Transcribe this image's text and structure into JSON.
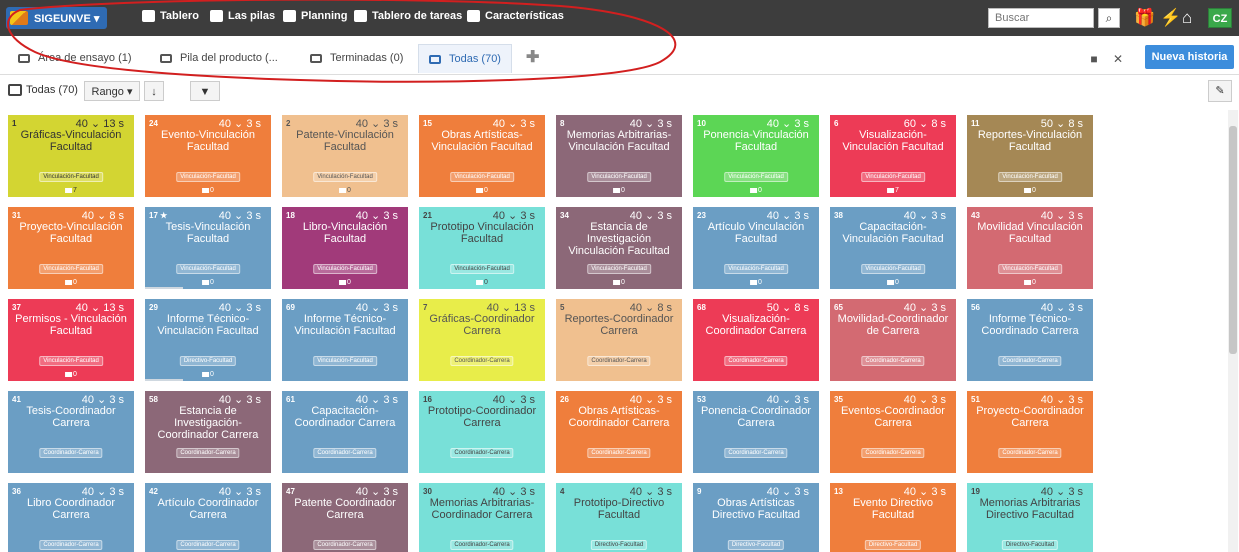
{
  "topbar": {
    "project": "SIGEUNVE ▾",
    "nav": [
      {
        "label": "Tablero",
        "icon": "dashboard-icon"
      },
      {
        "label": "Las pilas",
        "icon": "inbox-icon"
      },
      {
        "label": "Planning",
        "icon": "calendar-icon"
      },
      {
        "label": "Tablero de tareas",
        "icon": "taskboard-icon"
      },
      {
        "label": "Características",
        "icon": "features-icon"
      }
    ],
    "search_placeholder": "Buscar",
    "user_initials": "CZ"
  },
  "tabs": [
    {
      "label": "Área de ensayo (1)"
    },
    {
      "label": "Pila del producto (..."
    },
    {
      "label": "Terminadas (0)"
    },
    {
      "label": "Todas (70)"
    }
  ],
  "new_story_label": "Nueva historia",
  "filter": {
    "label": "Todas (70)",
    "range_label": "Rango ▾"
  },
  "cards": [
    {
      "num": "1",
      "pts": "40 ⌄ 13 s",
      "title": "Gráficas-Vinculación Facultad",
      "tag": "Vinculación-Facultad",
      "tasks": "7",
      "color": "#d3d532",
      "text": "#333333",
      "bar": 0
    },
    {
      "num": "24",
      "pts": "40 ⌄ 3 s",
      "title": "Evento-Vinculación Facultad",
      "tag": "Vinculación-Facultad",
      "tasks": "0",
      "color": "#ef7e3c",
      "text": "#ffffff",
      "bar": 0
    },
    {
      "num": "2",
      "pts": "40 ⌄ 3 s",
      "title": "Patente-Vinculación Facultad",
      "tag": "Vinculación-Facultad",
      "tasks": "0",
      "color": "#f0c08f",
      "text": "#555555",
      "bar": 0
    },
    {
      "num": "15",
      "pts": "40 ⌄ 3 s",
      "title": "Obras Artísticas-Vinculación Facultad",
      "tag": "Vinculación-Facultad",
      "tasks": "0",
      "color": "#ef7e3c",
      "text": "#ffffff",
      "bar": 0
    },
    {
      "num": "8",
      "pts": "40 ⌄ 3 s",
      "title": "Memorias Arbitrarias-Vinculación Facultad",
      "tag": "Vinculación-Facultad",
      "tasks": "0",
      "color": "#8c6878",
      "text": "#ffffff",
      "bar": 0
    },
    {
      "num": "10",
      "pts": "40 ⌄ 3 s",
      "title": "Ponencia-Vinculación Facultad",
      "tag": "Vinculación-Facultad",
      "tasks": "0",
      "color": "#5cd655",
      "text": "#ffffff",
      "bar": 0
    },
    {
      "num": "6",
      "pts": "60 ⌄ 8 s",
      "title": "Visualización-Vinculación Facultad",
      "tag": "Vinculación-Facultad",
      "tasks": "7",
      "color": "#ed3b56",
      "text": "#ffffff",
      "bar": 0
    },
    {
      "num": "11",
      "pts": "50 ⌄ 8 s",
      "title": "Reportes-Vinculación Facultad",
      "tag": "Vinculación-Facultad",
      "tasks": "0",
      "color": "#a58855",
      "text": "#ffffff",
      "bar": 0
    },
    {
      "num": "31",
      "pts": "40 ⌄ 8 s",
      "title": "Proyecto-Vinculación Facultad",
      "tag": "Vinculación-Facultad",
      "tasks": "0",
      "color": "#ef7e3c",
      "text": "#ffffff",
      "bar": 0
    },
    {
      "num": "17 ★",
      "pts": "40 ⌄ 3 s",
      "title": "Tesis-Vinculación Facultad",
      "tag": "Vinculación-Facultad",
      "tasks": "0",
      "color": "#6b9ec4",
      "text": "#ffffff",
      "bar": 0.3
    },
    {
      "num": "18",
      "pts": "40 ⌄ 3 s",
      "title": "Libro-Vinculación Facultad",
      "tag": "Vinculación-Facultad",
      "tasks": "0",
      "color": "#a13a7a",
      "text": "#ffffff",
      "bar": 0
    },
    {
      "num": "21",
      "pts": "40 ⌄ 3 s",
      "title": "Prototipo Vinculación Facultad",
      "tag": "Vinculación-Facultad",
      "tasks": "0",
      "color": "#78e0d8",
      "text": "#444444",
      "bar": 0
    },
    {
      "num": "34",
      "pts": "40 ⌄ 3 s",
      "title": "Estancia de Investigación Vinculación Facultad",
      "tag": "Vinculación-Facultad",
      "tasks": "0",
      "color": "#8c6878",
      "text": "#ffffff",
      "bar": 0
    },
    {
      "num": "23",
      "pts": "40 ⌄ 3 s",
      "title": "Artículo Vinculación Facultad",
      "tag": "Vinculación-Facultad",
      "tasks": "0",
      "color": "#6b9ec4",
      "text": "#ffffff",
      "bar": 0
    },
    {
      "num": "38",
      "pts": "40 ⌄ 3 s",
      "title": "Capacitación-Vinculación Facultad",
      "tag": "Vinculación-Facultad",
      "tasks": "0",
      "color": "#6b9ec4",
      "text": "#ffffff",
      "bar": 0
    },
    {
      "num": "43",
      "pts": "40 ⌄ 3 s",
      "title": "Movilidad Vinculación Facultad",
      "tag": "Vinculación-Facultad",
      "tasks": "0",
      "color": "#d36a72",
      "text": "#ffffff",
      "bar": 0
    },
    {
      "num": "37",
      "pts": "40 ⌄ 13 s",
      "title": "Permisos - Vinculación Facultad",
      "tag": "Vinculación-Facultad",
      "tasks": "0",
      "color": "#ed3b56",
      "text": "#ffffff",
      "bar": 0
    },
    {
      "num": "29",
      "pts": "40 ⌄ 3 s",
      "title": "Informe Técnico-Vinculación Facultad",
      "tag": "Directivo-Facultad",
      "tasks": "0",
      "color": "#6b9ec4",
      "text": "#ffffff",
      "bar": 0.3
    },
    {
      "num": "69",
      "pts": "40 ⌄ 3 s",
      "title": "Informe Técnico-Vinculación Facultad",
      "tag": "Vinculación-Facultad",
      "tasks": "",
      "color": "#6b9ec4",
      "text": "#ffffff",
      "bar": 0
    },
    {
      "num": "7",
      "pts": "40 ⌄ 13 s",
      "title": "Gráficas-Coordinador Carrera",
      "tag": "Coordinador-Carrera",
      "tasks": "",
      "color": "#e8ed4a",
      "text": "#555555",
      "bar": 0
    },
    {
      "num": "5",
      "pts": "40 ⌄ 8 s",
      "title": "Reportes-Coordinador Carrera",
      "tag": "Coordinador-Carrera",
      "tasks": "",
      "color": "#f0c08f",
      "text": "#555555",
      "bar": 0
    },
    {
      "num": "68",
      "pts": "50 ⌄ 8 s",
      "title": "Visualización-Coordinador Carrera",
      "tag": "Coordinador-Carrera",
      "tasks": "",
      "color": "#ed3b56",
      "text": "#ffffff",
      "bar": 0
    },
    {
      "num": "65",
      "pts": "40 ⌄ 3 s",
      "title": "Movilidad-Coordinador de Carrera",
      "tag": "Coordinador-Carrera",
      "tasks": "",
      "color": "#d36a72",
      "text": "#ffffff",
      "bar": 0
    },
    {
      "num": "56",
      "pts": "40 ⌄ 3 s",
      "title": "Informe Técnico-Coordinado Carrera",
      "tag": "Coordinador-Carrera",
      "tasks": "",
      "color": "#6b9ec4",
      "text": "#ffffff",
      "bar": 0
    },
    {
      "num": "41",
      "pts": "40 ⌄ 3 s",
      "title": "Tesis-Coordinador Carrera",
      "tag": "Coordinador-Carrera",
      "tasks": "",
      "color": "#6b9ec4",
      "text": "#ffffff",
      "bar": 0
    },
    {
      "num": "58",
      "pts": "40 ⌄ 3 s",
      "title": "Estancia de Investigación-Coordinador Carrera",
      "tag": "Coordinador-Carrera",
      "tasks": "",
      "color": "#8c6878",
      "text": "#ffffff",
      "bar": 0
    },
    {
      "num": "61",
      "pts": "40 ⌄ 3 s",
      "title": "Capacitación-Coordinador Carrera",
      "tag": "Coordinador-Carrera",
      "tasks": "",
      "color": "#6b9ec4",
      "text": "#ffffff",
      "bar": 0
    },
    {
      "num": "16",
      "pts": "40 ⌄ 3 s",
      "title": "Prototipo-Coordinador Carrera",
      "tag": "Coordinador-Carrera",
      "tasks": "",
      "color": "#78e0d8",
      "text": "#444444",
      "bar": 0
    },
    {
      "num": "26",
      "pts": "40 ⌄ 3 s",
      "title": "Obras Artísticas-Coordinador Carrera",
      "tag": "Coordinador-Carrera",
      "tasks": "",
      "color": "#ef7e3c",
      "text": "#ffffff",
      "bar": 0
    },
    {
      "num": "53",
      "pts": "40 ⌄ 3 s",
      "title": "Ponencia-Coordinador Carrera",
      "tag": "Coordinador-Carrera",
      "tasks": "",
      "color": "#6b9ec4",
      "text": "#ffffff",
      "bar": 0
    },
    {
      "num": "35",
      "pts": "40 ⌄ 3 s",
      "title": "Eventos-Coordinador Carrera",
      "tag": "Coordinador-Carrera",
      "tasks": "",
      "color": "#ef7e3c",
      "text": "#ffffff",
      "bar": 0
    },
    {
      "num": "51",
      "pts": "40 ⌄ 3 s",
      "title": "Proyecto-Coordinador Carrera",
      "tag": "Coordinador-Carrera",
      "tasks": "",
      "color": "#ef7e3c",
      "text": "#ffffff",
      "bar": 0
    },
    {
      "num": "36",
      "pts": "40 ⌄ 3 s",
      "title": "Libro Coordinador Carrera",
      "tag": "Coordinador-Carrera",
      "tasks": "",
      "color": "#6b9ec4",
      "text": "#ffffff",
      "bar": 0
    },
    {
      "num": "42",
      "pts": "40 ⌄ 3 s",
      "title": "Artículo Coordinador Carrera",
      "tag": "Coordinador-Carrera",
      "tasks": "",
      "color": "#6b9ec4",
      "text": "#ffffff",
      "bar": 0
    },
    {
      "num": "47",
      "pts": "40 ⌄ 3 s",
      "title": "Patente Coordinador Carrera",
      "tag": "Coordinador-Carrera",
      "tasks": "",
      "color": "#8c6878",
      "text": "#ffffff",
      "bar": 0
    },
    {
      "num": "30",
      "pts": "40 ⌄ 3 s",
      "title": "Memorias Arbitrarias-Coordinador Carrera",
      "tag": "Coordinador-Carrera",
      "tasks": "",
      "color": "#78e0d8",
      "text": "#444444",
      "bar": 0
    },
    {
      "num": "4",
      "pts": "40 ⌄ 3 s",
      "title": "Prototipo-Directivo Facultad",
      "tag": "Directivo-Facultad",
      "tasks": "",
      "color": "#78e0d8",
      "text": "#444444",
      "bar": 0
    },
    {
      "num": "9",
      "pts": "40 ⌄ 3 s",
      "title": "Obras Artísticas Directivo Facultad",
      "tag": "Directivo-Facultad",
      "tasks": "",
      "color": "#6b9ec4",
      "text": "#ffffff",
      "bar": 0
    },
    {
      "num": "13",
      "pts": "40 ⌄ 3 s",
      "title": "Evento Directivo Facultad",
      "tag": "Directivo-Facultad",
      "tasks": "",
      "color": "#ef7e3c",
      "text": "#ffffff",
      "bar": 0
    },
    {
      "num": "19",
      "pts": "40 ⌄ 3 s",
      "title": "Memorias Arbitrarias Directivo Facultad",
      "tag": "Directivo-Facultad",
      "tasks": "",
      "color": "#78e0d8",
      "text": "#444444",
      "bar": 0
    }
  ]
}
